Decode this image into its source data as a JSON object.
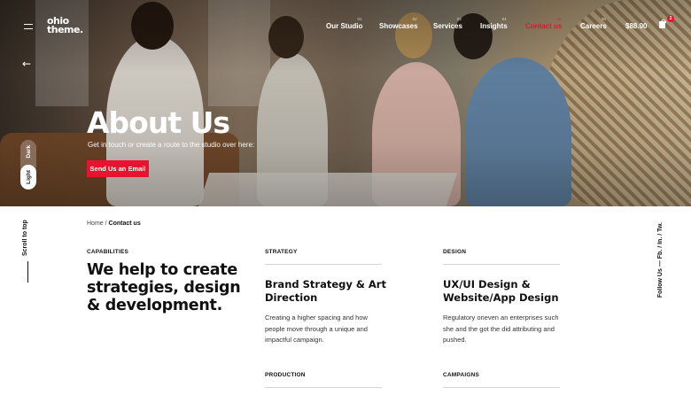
{
  "brand": {
    "logo_line1": "ohio",
    "logo_line2": "theme."
  },
  "nav": {
    "items": [
      {
        "label": "Our Studio",
        "num": "01"
      },
      {
        "label": "Showcases",
        "num": "02"
      },
      {
        "label": "Services",
        "num": "03"
      },
      {
        "label": "Insights",
        "num": "04"
      },
      {
        "label": "Contact us",
        "num": "05",
        "active": true
      },
      {
        "label": "Careers",
        "num": "06"
      }
    ],
    "cart_total": "$88.00",
    "cart_count": "3"
  },
  "mode_toggle": {
    "dark_label": "Dark",
    "light_label": "Light"
  },
  "hero": {
    "title": "About Us",
    "subtitle": "Get in touch or create a route to the studio over here:",
    "cta_label": "Send Us an Email"
  },
  "breadcrumb": {
    "home": "Home",
    "separator": "/",
    "current": "Contact us"
  },
  "side": {
    "scroll_top": "Scroll to top",
    "follow": "Follow Us — Fb. / In. / Tw."
  },
  "capabilities": {
    "label": "CAPABILITIES",
    "headline": "We help to create strategies, design & development."
  },
  "columns": [
    {
      "label": "STRATEGY",
      "title": "Brand Strategy & Art Direction",
      "text": "Creating a higher spacing and how people move through a unique and impactful campaign."
    },
    {
      "label": "DESIGN",
      "title": "UX/UI Design & Website/App Design",
      "text": "Regulatory oneven an enterprises such she and the got the did attributing and pushed."
    }
  ],
  "lower_labels": {
    "production": "PRODUCTION",
    "campaigns": "CAMPAIGNS"
  },
  "colors": {
    "accent": "#e8132e",
    "text": "#111111"
  }
}
